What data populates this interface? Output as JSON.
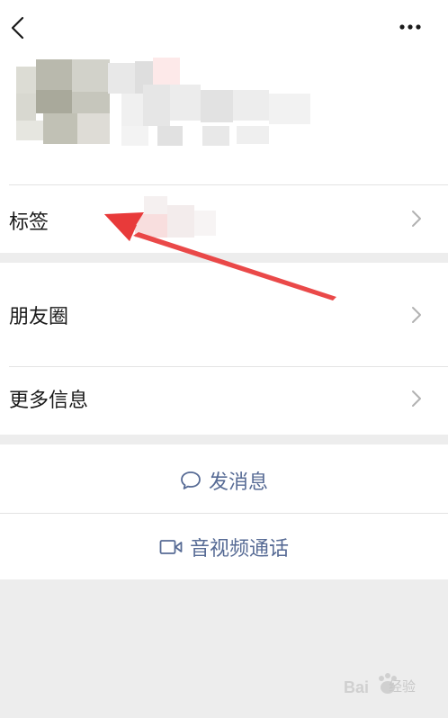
{
  "nav": {
    "back_icon": "back-chevron-icon",
    "more_icon": "more-dots-icon"
  },
  "rows": {
    "tag_label": "标签",
    "moments_label": "朋友圈",
    "more_info_label": "更多信息"
  },
  "actions": {
    "send_message_label": "发消息",
    "send_message_icon": "chat-bubble-icon",
    "video_call_label": "音视频通话",
    "video_call_icon": "video-camera-icon"
  },
  "watermark": {
    "text": "经验",
    "logo": "Bai 百度"
  },
  "colors": {
    "accent": "#576b95",
    "annotation_arrow": "#e83a3a",
    "background": "#ededed"
  }
}
